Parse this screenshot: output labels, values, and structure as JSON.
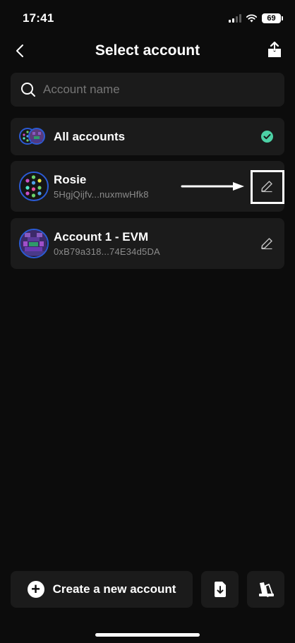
{
  "status_bar": {
    "time": "17:41",
    "battery": "69"
  },
  "header": {
    "title": "Select account"
  },
  "search": {
    "placeholder": "Account name"
  },
  "accounts": {
    "all": {
      "name": "All accounts"
    },
    "list": [
      {
        "name": "Rosie",
        "address": "5HgjQijfv...nuxmwHfk8"
      },
      {
        "name": "Account 1 - EVM",
        "address": "0xB79a318...74E34d5DA"
      }
    ]
  },
  "footer": {
    "create_label": "Create a new account"
  },
  "colors": {
    "background": "#0c0c0c",
    "card": "#1b1b1b",
    "accent_green": "#4cd1a5",
    "avatar_ring": "#2b5bd6"
  }
}
